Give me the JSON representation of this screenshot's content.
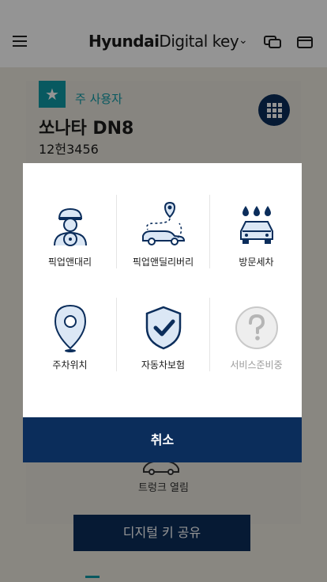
{
  "header": {
    "brand_bold": "Hyundai",
    "brand_light": "Digital key",
    "chevron": "⌄"
  },
  "vehicle": {
    "role": "주 사용자",
    "name": "쏘나타 DN8",
    "plate": "12헌3456"
  },
  "controls": {
    "trunk_label": "트렁크 열림",
    "share_label": "디지털 키 공유"
  },
  "modal": {
    "services": [
      {
        "label": "픽업앤대리",
        "icon": "valet-driver-icon",
        "enabled": true
      },
      {
        "label": "픽업앤딜리버리",
        "icon": "delivery-car-icon",
        "enabled": true
      },
      {
        "label": "방문세차",
        "icon": "car-wash-icon",
        "enabled": true
      },
      {
        "label": "주차위치",
        "icon": "parking-pin-icon",
        "enabled": true
      },
      {
        "label": "자동차보험",
        "icon": "insurance-shield-icon",
        "enabled": true
      },
      {
        "label": "서비스준비중",
        "icon": "question-icon",
        "enabled": false
      }
    ],
    "cancel_label": "취소"
  },
  "colors": {
    "navy": "#0b2d5b",
    "teal": "#0e9aa6",
    "icon_fill": "#dbe7f5"
  }
}
